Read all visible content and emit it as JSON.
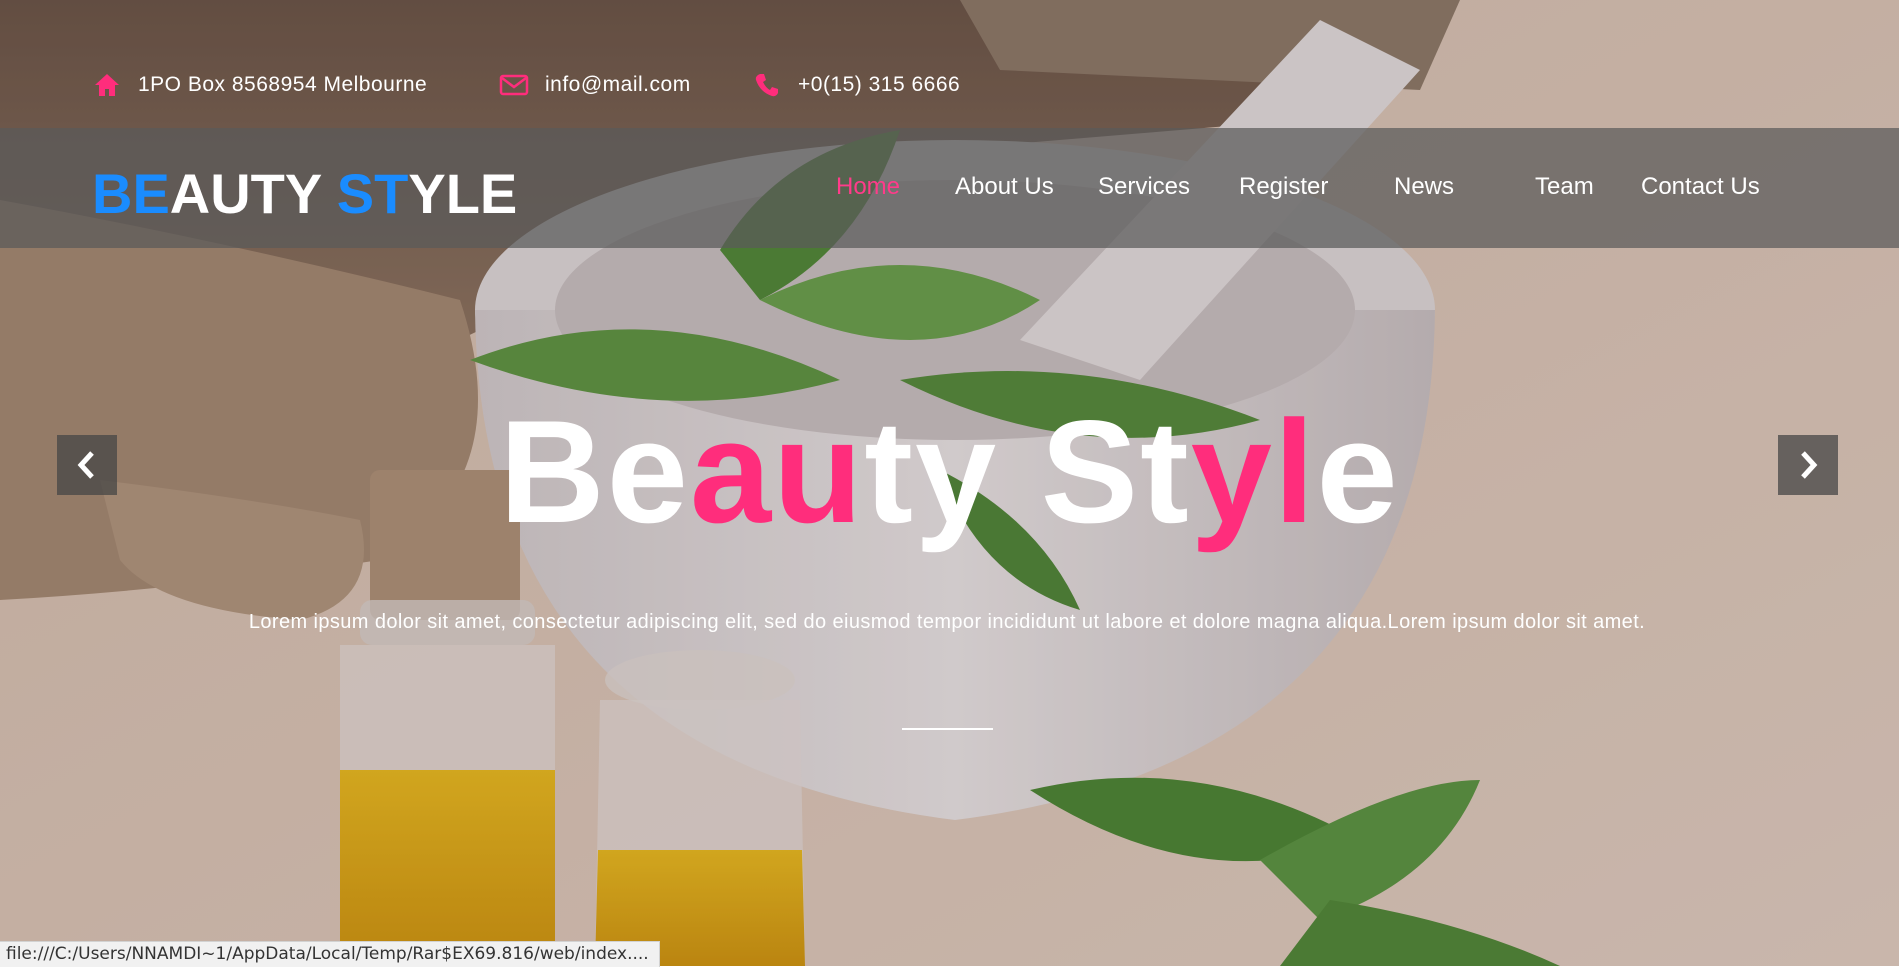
{
  "topbar": {
    "address": "1PO Box 8568954 Melbourne",
    "email": "info@mail.com",
    "phone": "+0(15) 315 6666"
  },
  "logo": {
    "part1": "BE",
    "part2": "AUTY ",
    "part3": "ST",
    "part4": "YLE"
  },
  "nav": {
    "home": "Home",
    "about": "About Us",
    "services": "Services",
    "register": "Register",
    "news": "News",
    "team": "Team",
    "contact": "Contact Us"
  },
  "hero": {
    "title_1": "Be",
    "title_2": "au",
    "title_3": "ty St",
    "title_4": "yl",
    "title_5": "e",
    "text": "Lorem ipsum dolor sit amet, consectetur adipiscing elit, sed do eiusmod tempor incididunt ut labore et dolore magna aliqua.Lorem ipsum dolor sit amet."
  },
  "status": {
    "url": "file:///C:/Users/NNAMDI~1/AppData/Local/Temp/Rar$EX69.816/web/index...."
  },
  "colors": {
    "accent_pink": "#ff2d7c",
    "logo_blue": "#1a8cff",
    "nav_bg": "#5a5a5a"
  },
  "icons": {
    "address": "home-icon",
    "email": "envelope-icon",
    "phone": "phone-icon",
    "prev": "chevron-left-icon",
    "next": "chevron-right-icon"
  }
}
